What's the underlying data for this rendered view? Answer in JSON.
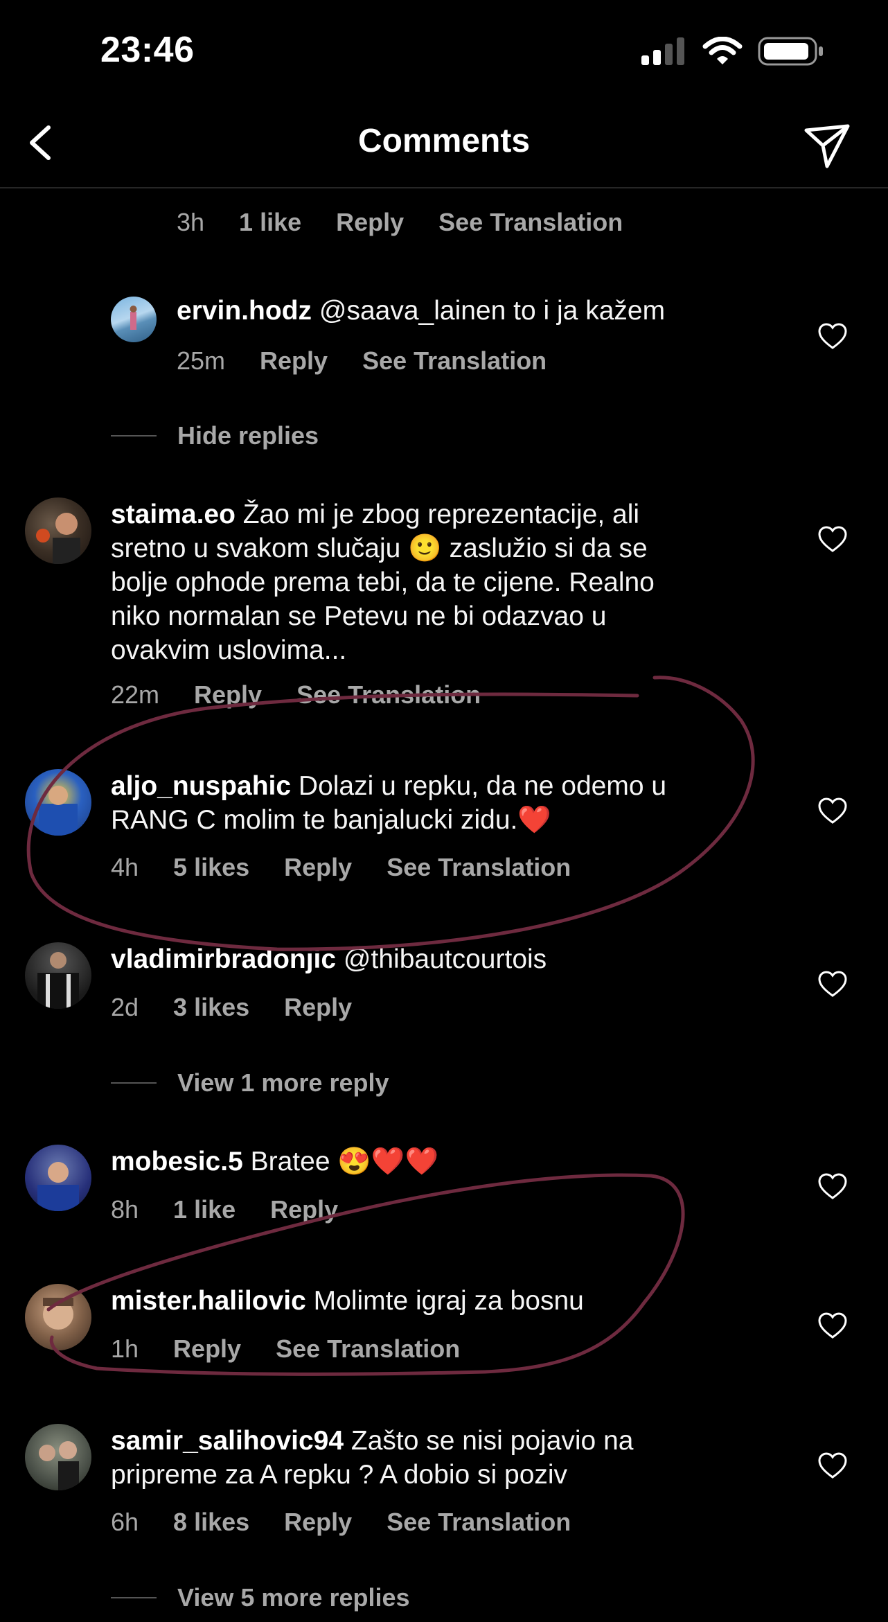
{
  "status": {
    "time": "23:46"
  },
  "nav": {
    "title": "Comments"
  },
  "top_meta": {
    "time": "3h",
    "likes": "1 like",
    "reply": "Reply",
    "translate": "See Translation"
  },
  "reply_ervin": {
    "username": "ervin.hodz",
    "text": " @saava_lainen to i ja kažem",
    "time": "25m",
    "reply": "Reply",
    "translate": "See Translation"
  },
  "hide_replies": "Hide replies",
  "comments": [
    {
      "username": "staima.eo",
      "line1": " Žao mi je zbog reprezentacije, ali",
      "line2": "sretno u svakom slučaju 🙂 zaslužio si da se",
      "line3": "bolje ophode prema tebi, da te cijene. Realno",
      "line4": "niko normalan se Petevu ne bi odazvao u",
      "line5": "ovakvim uslovima...",
      "time": "22m",
      "reply": "Reply",
      "translate": "See Translation"
    },
    {
      "username": "aljo_nuspahic",
      "line1": " Dolazi u repku, da ne odemo u",
      "line2": "RANG C molim te banjalucki zidu.❤️",
      "time": "4h",
      "likes": "5 likes",
      "reply": "Reply",
      "translate": "See Translation"
    },
    {
      "username": "vladimirbradonjic",
      "line1": " @thibautcourtois",
      "time": "2d",
      "likes": "3 likes",
      "reply": "Reply"
    },
    {
      "username": "mobesic.5",
      "line1": " Bratee 😍❤️❤️",
      "time": "8h",
      "likes": "1 like",
      "reply": "Reply"
    },
    {
      "username": "mister.halilovic",
      "line1": " Molimte igraj za bosnu",
      "time": "1h",
      "reply": "Reply",
      "translate": "See Translation"
    },
    {
      "username": "samir_salihovic94",
      "line1": " Zašto se nisi pojavio na",
      "line2": "pripreme za A repku ? A dobio si poziv",
      "time": "6h",
      "likes": "8 likes",
      "reply": "Reply",
      "translate": "See Translation"
    }
  ],
  "view_more_1": "View 1 more reply",
  "view_more_5": "View 5 more replies",
  "colors": {
    "background": "#000000",
    "text": "#ffffff",
    "secondary": "#a8a8a8",
    "annotation": "#6e2a3f"
  }
}
